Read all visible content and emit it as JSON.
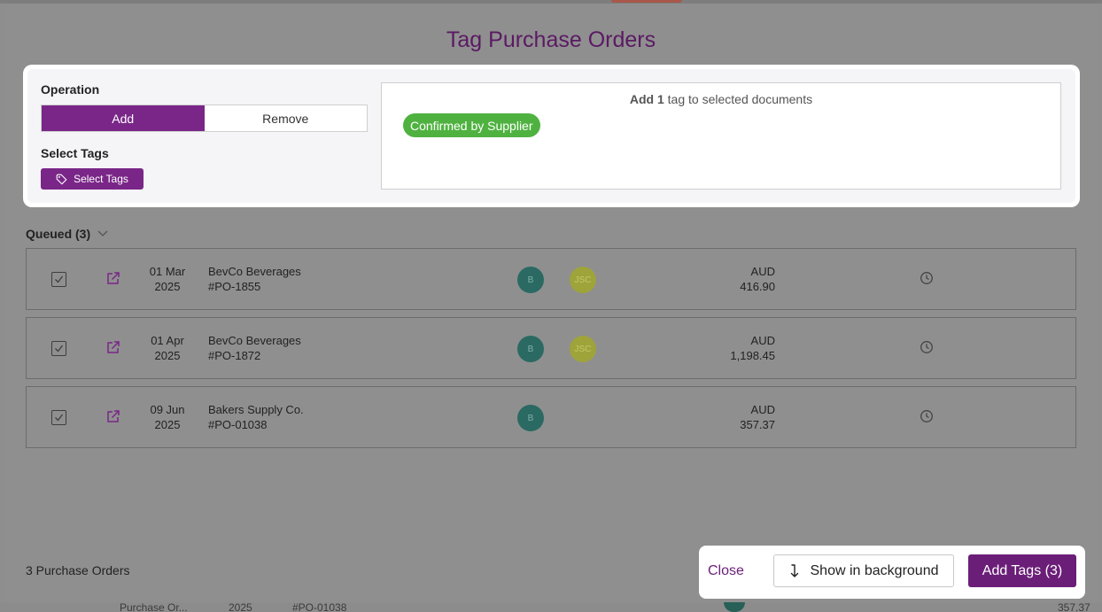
{
  "modal": {
    "title": "Tag Purchase Orders",
    "operation_label": "Operation",
    "operation_options": [
      "Add",
      "Remove"
    ],
    "operation_selected": "Add",
    "select_tags_label": "Select Tags",
    "select_tags_button": "Select Tags",
    "summary_prefix": "Add",
    "summary_count": "1",
    "summary_suffix": "tag to selected documents",
    "tags": [
      "Confirmed by Supplier"
    ],
    "queued_label": "Queued (3)",
    "rows": [
      {
        "date_day": "01 Mar",
        "date_year": "2025",
        "supplier": "BevCo Beverages",
        "po": "#PO-1855",
        "avatars": [
          "B",
          "JSC"
        ],
        "currency": "AUD",
        "amount": "416.90"
      },
      {
        "date_day": "01 Apr",
        "date_year": "2025",
        "supplier": "BevCo Beverages",
        "po": "#PO-1872",
        "avatars": [
          "B",
          "JSC"
        ],
        "currency": "AUD",
        "amount": "1,198.45"
      },
      {
        "date_day": "09 Jun",
        "date_year": "2025",
        "supplier": "Bakers Supply Co.",
        "po": "#PO-01038",
        "avatars": [
          "B"
        ],
        "currency": "AUD",
        "amount": "357.37"
      }
    ],
    "count_label": "3 Purchase Orders",
    "footer": {
      "close": "Close",
      "show_background": "Show in background",
      "add_tags": "Add Tags (3)"
    }
  },
  "background_peek": {
    "cells": [
      "Purchase Or...",
      "2025",
      "#PO-01038",
      "357.37"
    ]
  },
  "colors": {
    "brand_purple": "#7a2688",
    "tag_green": "#4fb240",
    "title_purple": "#5b1a63"
  }
}
